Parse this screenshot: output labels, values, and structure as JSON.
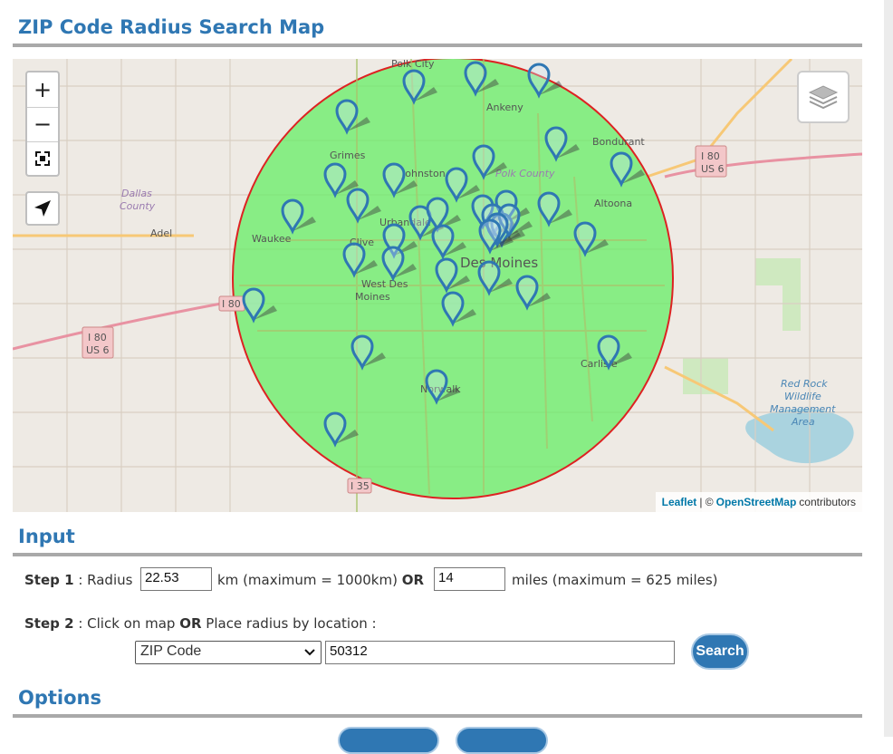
{
  "page": {
    "title": "ZIP Code Radius Search Map",
    "input_title": "Input",
    "options_title": "Options"
  },
  "map": {
    "zoom_in": "+",
    "zoom_out": "−",
    "place_labels": [
      "Polk City",
      "Ankeny",
      "Bondurant",
      "Grimes",
      "Johnston",
      "Polk County",
      "Altoona",
      "Dallas County",
      "Adel",
      "Waukee",
      "Urbandale",
      "Clive",
      "Des Moines",
      "West Des Moines",
      "Carlisle",
      "Norwalk",
      "Red Rock Wildlife Management Area"
    ],
    "shields": [
      "I 80",
      "US 6",
      "I 80",
      "US 6",
      "I 80",
      "I 35"
    ],
    "attribution": {
      "leaflet": "Leaflet",
      "sep": "| ©",
      "osm": "OpenStreetMap",
      "contrib": "contributors"
    },
    "circle_color": "#66ee66",
    "circle_border": "#dd2222",
    "marker_color": "#2f77b3"
  },
  "step1": {
    "label": "Step 1",
    "sep": " : Radius ",
    "km_value": "22.53",
    "km_text": " km (maximum = 1000km) ",
    "or": "OR",
    "miles_value": "14",
    "miles_text": "miles (maximum = 625 miles)"
  },
  "step2": {
    "label": "Step 2",
    "text1": " : Click on map ",
    "or": "OR",
    "text2": " Place radius by location :",
    "select_value": "ZIP Code",
    "location_value": "50312",
    "search_label": "Search"
  }
}
